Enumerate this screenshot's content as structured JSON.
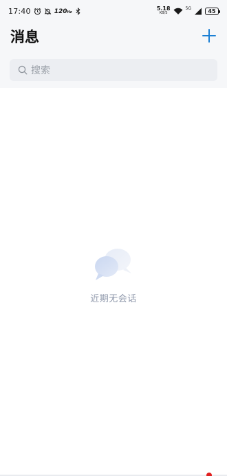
{
  "status_bar": {
    "time": "17:40",
    "refresh_rate": "120",
    "refresh_rate_unit": "Hz",
    "net_speed_value": "5.18",
    "net_speed_unit": "KB/S",
    "signal_label": "5G",
    "battery": "45",
    "icons": [
      "alarm-icon",
      "mute-bell-icon",
      "bluetooth-icon",
      "wifi-icon",
      "cell-signal-icon",
      "battery-icon"
    ]
  },
  "header": {
    "title": "消息",
    "add_icon": "plus-icon"
  },
  "search": {
    "placeholder": "搜索",
    "icon": "search-icon"
  },
  "empty_state": {
    "icon": "chat-bubbles-icon",
    "text": "近期无会话"
  },
  "colors": {
    "accent": "#1a7fd4",
    "empty_text": "#8f98ab",
    "notification_dot": "#e02020"
  }
}
